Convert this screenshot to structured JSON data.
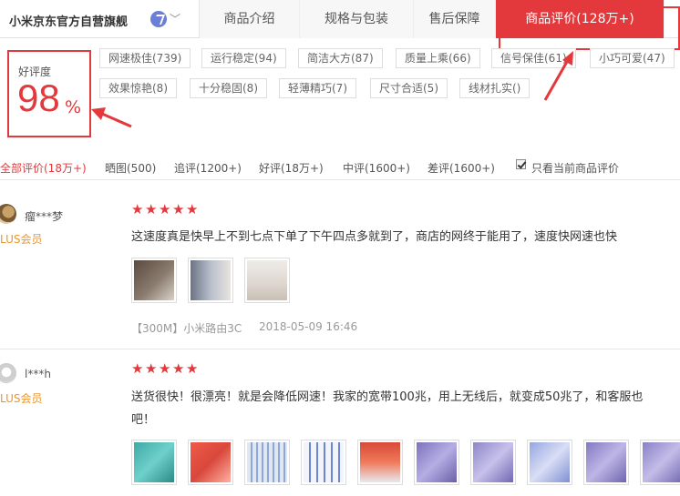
{
  "store": {
    "name": "小米京东官方自营旗舰",
    "chevron": "﹀",
    "follow_icon": "follow-icon",
    "colors": {
      "brand": "#e4393c",
      "follow": "#6b7fd7"
    }
  },
  "tabs": [
    {
      "label": "商品介绍"
    },
    {
      "label": "规格与包装"
    },
    {
      "label": "售后保障"
    },
    {
      "label": "商品评价(128万+)"
    }
  ],
  "rating": {
    "label": "好评度",
    "value": "98",
    "unit": "%"
  },
  "tags": [
    "网速极佳(739)",
    "运行稳定(94)",
    "简洁大方(87)",
    "质量上乘(66)",
    "信号保佳(61)",
    "小巧可爱(47)",
    "效果惊艳(8)",
    "十分稳固(8)",
    "轻薄精巧(7)",
    "尺寸合适(5)",
    "线材扎实()"
  ],
  "filters": [
    "全部评价(18万+)",
    "晒图(500)",
    "追评(1200+)",
    "好评(18万+)",
    "中评(1600+)",
    "差评(1600+)"
  ],
  "only_current_label": "只看当前商品评价",
  "only_current_checked": true,
  "reviews": [
    {
      "user": "瘤***梦",
      "level": "LUS会员",
      "stars": 5,
      "text_lines": [
        "这速度真是快早上不到七点下单了下午四点多就到了，商店的网终于能用了，速度快网速也快"
      ],
      "thumb_colors": [
        "#6d5b4f",
        "#8a8f9c",
        "#e6e1db"
      ],
      "product": "【300M】小米路由3C",
      "date": "2018-05-09 16:46"
    },
    {
      "user": "l***h",
      "level": "LUS会员",
      "stars": 5,
      "text_lines": [
        "送货很快！很漂亮！就是会降低网速！我家的宽带100兆，用上无线后，就变成50兆了，和客服也",
        "吧！"
      ],
      "thumb_colors": [
        "#4fb8b4",
        "#e35a4e",
        "#dfe7f2",
        "#9fb3e8",
        "#e0563f",
        "#8e86c9",
        "#8e86c9",
        "#a4b2e6",
        "#8e86c9",
        "#8e86c9"
      ]
    }
  ]
}
